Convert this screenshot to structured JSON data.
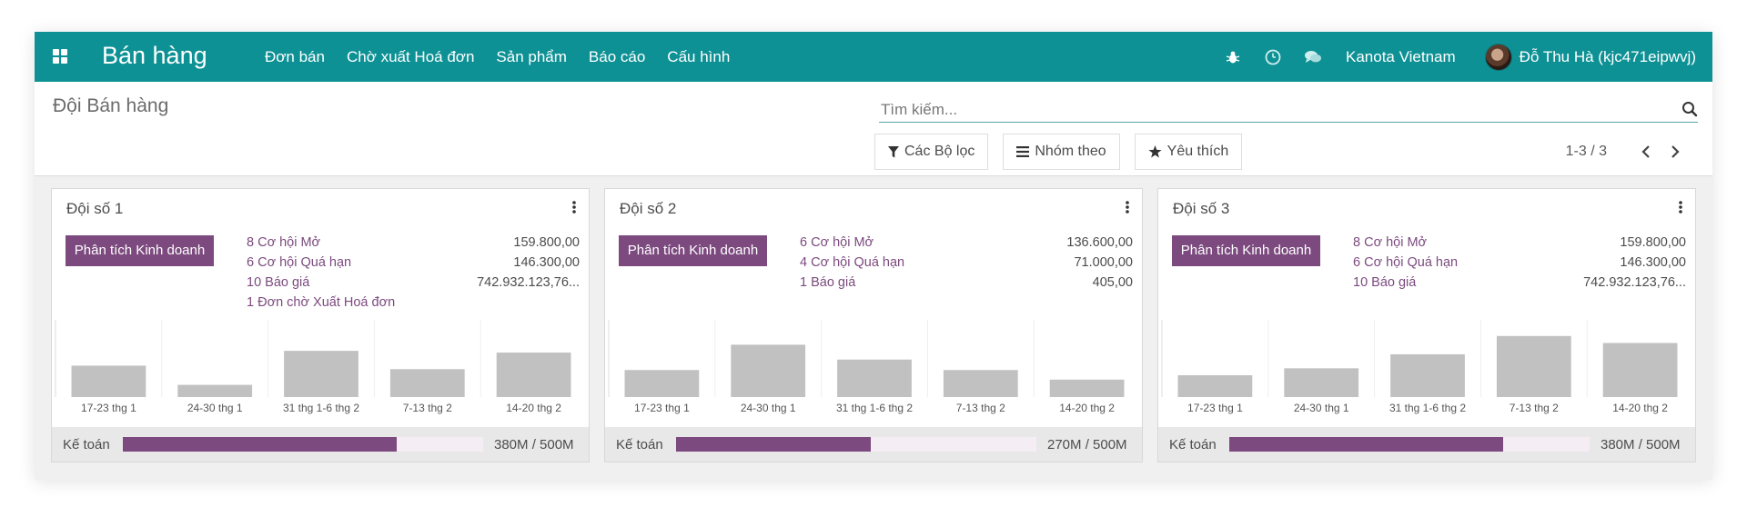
{
  "app": {
    "title": "Bán hàng",
    "menu": [
      "Đơn bán",
      "Chờ xuất Hoá đơn",
      "Sản phẩm",
      "Báo cáo",
      "Cấu hình"
    ],
    "systray_icons": [
      "bug-icon",
      "clock-icon",
      "chat-icon"
    ],
    "company": "Kanota Vietnam",
    "user": "Đỗ Thu Hà (kjc471eipwvj)"
  },
  "control": {
    "breadcrumb": "Đội Bán hàng",
    "search_placeholder": "Tìm kiếm...",
    "filters_label": "Các Bộ lọc",
    "group_by_label": "Nhóm theo",
    "favorites_label": "Yêu thích",
    "pager": "1-3 / 3"
  },
  "colors": {
    "navbar": "#0e9195",
    "primary": "#7c4a7f",
    "bar": "#c1c1c1"
  },
  "teams": [
    {
      "name": "Đội số 1",
      "button": "Phân tích Kinh doanh",
      "links": [
        {
          "label": "8 Cơ hội Mở",
          "value": "159.800,00"
        },
        {
          "label": "6 Cơ hội Quá hạn",
          "value": "146.300,00"
        },
        {
          "label": "10 Báo giá",
          "value": "742.932.123,76..."
        },
        {
          "label": "1 Đơn chờ Xuất Hoá đơn",
          "value": ""
        }
      ],
      "chart_data": {
        "type": "bar",
        "categories": [
          "17-23 thg 1",
          "24-30 thg 1",
          "31 thg 1-6 thg 2",
          "7-13 thg 2",
          "14-20 thg 2"
        ],
        "values": [
          36,
          14,
          53,
          32,
          51
        ]
      },
      "footer_label": "Kế toán",
      "progress": 0.76,
      "progress_text": "380M / 500M"
    },
    {
      "name": "Đội số 2",
      "button": "Phân tích Kinh doanh",
      "links": [
        {
          "label": "6 Cơ hội Mở",
          "value": "136.600,00"
        },
        {
          "label": "4 Cơ hội Quá hạn",
          "value": "71.000,00"
        },
        {
          "label": "1 Báo giá",
          "value": "405,00"
        }
      ],
      "chart_data": {
        "type": "bar",
        "categories": [
          "17-23 thg 1",
          "24-30 thg 1",
          "31 thg 1-6 thg 2",
          "7-13 thg 2",
          "14-20 thg 2"
        ],
        "values": [
          31,
          60,
          43,
          31,
          20
        ]
      },
      "footer_label": "Kế toán",
      "progress": 0.54,
      "progress_text": "270M / 500M"
    },
    {
      "name": "Đội số 3",
      "button": "Phân tích Kinh doanh",
      "links": [
        {
          "label": "8 Cơ hội Mở",
          "value": "159.800,00"
        },
        {
          "label": "6 Cơ hội Quá hạn",
          "value": "146.300,00"
        },
        {
          "label": "10 Báo giá",
          "value": "742.932.123,76..."
        }
      ],
      "chart_data": {
        "type": "bar",
        "categories": [
          "17-23 thg 1",
          "24-30 thg 1",
          "31 thg 1-6 thg 2",
          "7-13 thg 2",
          "14-20 thg 2"
        ],
        "values": [
          25,
          33,
          49,
          70,
          62
        ]
      },
      "footer_label": "Kế toán",
      "progress": 0.76,
      "progress_text": "380M / 500M"
    }
  ]
}
